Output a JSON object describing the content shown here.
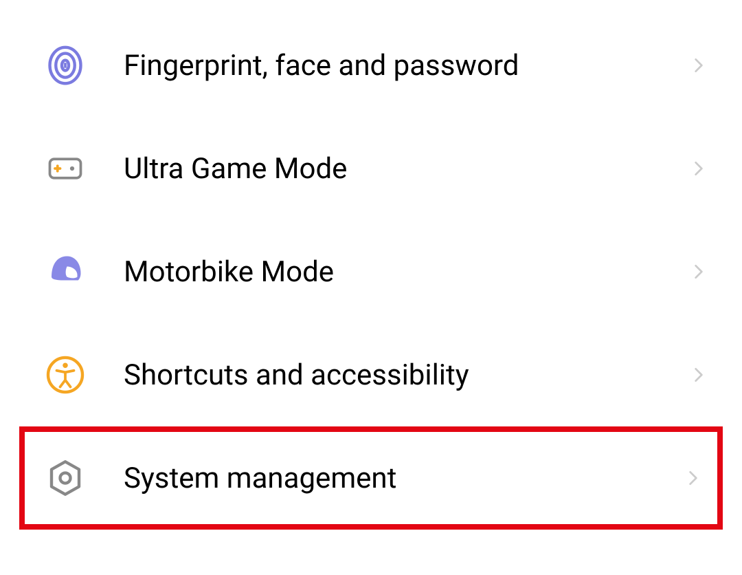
{
  "settings": {
    "items": [
      {
        "label": "Fingerprint, face and password",
        "icon": "fingerprint",
        "highlighted": false
      },
      {
        "label": "Ultra Game Mode",
        "icon": "gamepad",
        "highlighted": false
      },
      {
        "label": "Motorbike Mode",
        "icon": "helmet",
        "highlighted": false
      },
      {
        "label": "Shortcuts and accessibility",
        "icon": "accessibility",
        "highlighted": false
      },
      {
        "label": "System management",
        "icon": "gear-hex",
        "highlighted": true
      }
    ]
  },
  "colors": {
    "purple": "#7b7be0",
    "orange": "#f5a623",
    "gray": "#888888",
    "lightgray": "#cccccc",
    "highlight": "#e30613"
  }
}
